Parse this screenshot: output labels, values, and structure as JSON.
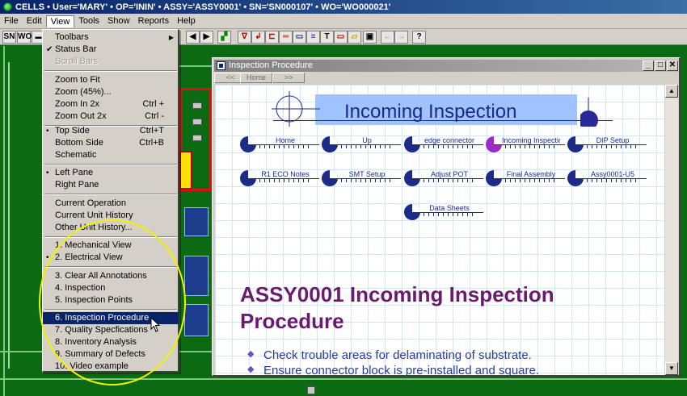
{
  "app": {
    "title": "CELLS • User='MARY' • OP='ININ' • ASSY='ASSY0001' • SN='SN000107' • WO='WO000021'"
  },
  "menubar": [
    "File",
    "Edit",
    "View",
    "Tools",
    "Show",
    "Reports",
    "Help"
  ],
  "toolbar": {
    "sn_label": "SN",
    "wo_label": "WO"
  },
  "view_menu": {
    "items": [
      {
        "label": "Toolbars",
        "mark": "",
        "accel": "",
        "arrow": "▶"
      },
      {
        "label": "Status Bar",
        "mark": "✔",
        "accel": ""
      },
      {
        "label": "Scroll Bars",
        "mark": "",
        "accel": "",
        "disabled": true
      },
      {
        "label": "Zoom to Fit",
        "mark": "",
        "accel": ""
      },
      {
        "label": "Zoom (45%)...",
        "mark": "",
        "accel": ""
      },
      {
        "label": "Zoom In 2x",
        "mark": "",
        "accel": "Ctrl +"
      },
      {
        "label": "Zoom Out 2x",
        "mark": "",
        "accel": "Ctrl -"
      },
      {
        "label": "Top Side",
        "mark": "•",
        "accel": "Ctrl+T"
      },
      {
        "label": "Bottom Side",
        "mark": "",
        "accel": "Ctrl+B"
      },
      {
        "label": "Schematic",
        "mark": "",
        "accel": ""
      },
      {
        "label": "Left Pane",
        "mark": "•",
        "accel": ""
      },
      {
        "label": "Right Pane",
        "mark": "",
        "accel": ""
      },
      {
        "label": "Current Operation",
        "mark": "",
        "accel": ""
      },
      {
        "label": "Current Unit History",
        "mark": "",
        "accel": ""
      },
      {
        "label": "Other Unit History...",
        "mark": "",
        "accel": ""
      },
      {
        "label": "1. Mechanical View",
        "mark": "",
        "accel": ""
      },
      {
        "label": "2. Electrical View",
        "mark": "•",
        "accel": ""
      },
      {
        "label": "3. Clear All Annotations",
        "mark": "",
        "accel": ""
      },
      {
        "label": "4. Inspection",
        "mark": "",
        "accel": ""
      },
      {
        "label": "5. Inspection Points",
        "mark": "",
        "accel": ""
      },
      {
        "label": "6. Inspection Procedure",
        "mark": "",
        "accel": "",
        "selected": true
      },
      {
        "label": "7. Quality Specfications",
        "mark": "",
        "accel": ""
      },
      {
        "label": "8. Inventory Analysis",
        "mark": "",
        "accel": ""
      },
      {
        "label": "9. Summary of Defects",
        "mark": "",
        "accel": ""
      },
      {
        "label": "10. Video example",
        "mark": "",
        "accel": ""
      }
    ]
  },
  "inspection_window": {
    "title": "Inspection Procedure",
    "nav": [
      "<<",
      "Home",
      ">>"
    ],
    "banner_title": "Incoming Inspection",
    "links": [
      {
        "label": "Home"
      },
      {
        "label": "Up"
      },
      {
        "label": "edge connector"
      },
      {
        "label": "Incoming Inspection",
        "active": true
      },
      {
        "label": "DIP Setup"
      },
      {
        "label": "R1 ECO Notes"
      },
      {
        "label": "SMT Setup"
      },
      {
        "label": "Adjust POT"
      },
      {
        "label": "Final Assembly"
      },
      {
        "label": "Assy0001-U5"
      },
      {
        "label": "Data Sheets"
      }
    ],
    "doc_title_line1": "ASSY0001 Incoming Inspection",
    "doc_title_line2": "Procedure",
    "bullets": [
      "Check trouble areas for delaminating of substrate.",
      "Ensure connector block is pre-installed and square."
    ]
  }
}
